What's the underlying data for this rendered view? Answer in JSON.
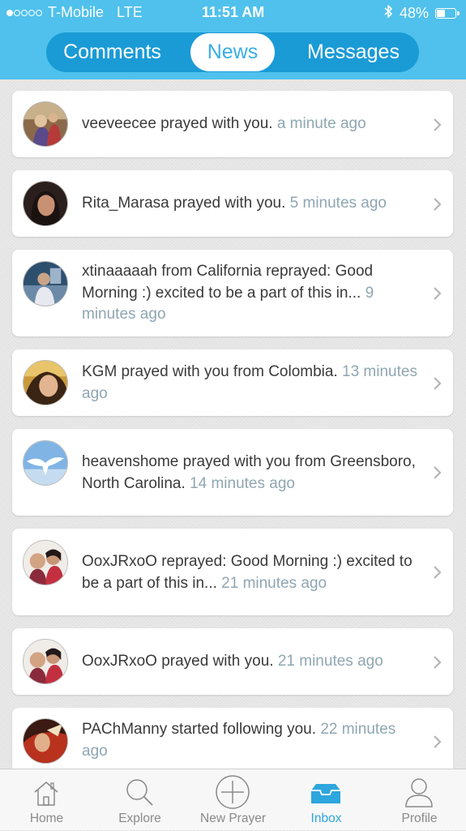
{
  "status_bar": {
    "carrier": "T-Mobile",
    "network": "LTE",
    "time": "11:51 AM",
    "battery": "48%",
    "battery_level": 0.48,
    "signal_bars_filled": 1,
    "signal_bars_total": 5
  },
  "segments": [
    {
      "label": "Comments",
      "active": false
    },
    {
      "label": "News",
      "active": true
    },
    {
      "label": "Messages",
      "active": false
    }
  ],
  "feed": [
    {
      "user": "veeveecee",
      "text": " prayed with you. ",
      "time": "a minute ago"
    },
    {
      "user": "Rita_Marasa",
      "text": " prayed with you. ",
      "time": "5 minutes ago"
    },
    {
      "user": "xtinaaaaah",
      "text": " from California reprayed: Good Morning :) excited to be a part of this in... ",
      "time": "9 minutes ago"
    },
    {
      "user": "KGM",
      "text": " prayed with you from Colombia. ",
      "time": "13 minutes ago"
    },
    {
      "user": "heavenshome",
      "text": " prayed with you from Greensboro, North Carolina. ",
      "time": "14 minutes ago"
    },
    {
      "user": "OoxJRxoO",
      "text": " reprayed: Good Morning :) excited to be a part of this in... ",
      "time": "21 minutes ago"
    },
    {
      "user": "OoxJRxoO",
      "text": " prayed with you. ",
      "time": "21 minutes ago"
    },
    {
      "user": "PAChManny",
      "text": " started following you. ",
      "time": "22 minutes ago"
    }
  ],
  "tabs": [
    {
      "label": "Home",
      "icon": "home-icon",
      "active": false
    },
    {
      "label": "Explore",
      "icon": "search-icon",
      "active": false
    },
    {
      "label": "New Prayer",
      "icon": "plus-circle-icon",
      "active": false
    },
    {
      "label": "Inbox",
      "icon": "inbox-icon",
      "active": true
    },
    {
      "label": "Profile",
      "icon": "profile-icon",
      "active": false
    }
  ],
  "colors": {
    "header": "#4fc1ec",
    "segment_track": "#1a9bd6",
    "active_tab": "#2ea6de",
    "timestamp": "#8fa6b2"
  }
}
